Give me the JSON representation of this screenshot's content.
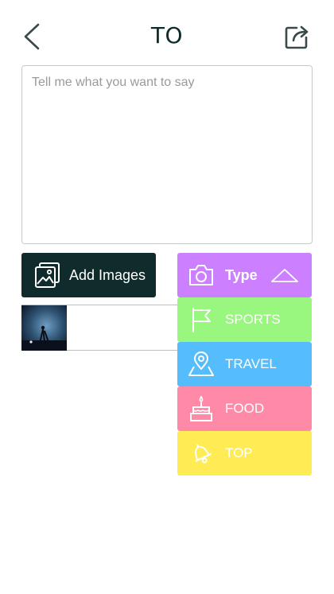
{
  "header": {
    "title": "TO"
  },
  "message": {
    "placeholder": "Tell me what you want to say",
    "value": ""
  },
  "add_images": {
    "label": "Add Images"
  },
  "type_menu": {
    "header_label": "Type",
    "header_color": "#cc80ff",
    "items": [
      {
        "label": "SPORTS",
        "icon": "flag-icon",
        "color": "#99f77f"
      },
      {
        "label": "TRAVEL",
        "icon": "map-pin-icon",
        "color": "#55bdfc"
      },
      {
        "label": "FOOD",
        "icon": "cake-icon",
        "color": "#ff8aa8"
      },
      {
        "label": "TOP",
        "icon": "bell-icon",
        "color": "#ffec55"
      }
    ]
  },
  "colors": {
    "primary_dark": "#0f2b2b",
    "border": "#c9c9c9"
  }
}
